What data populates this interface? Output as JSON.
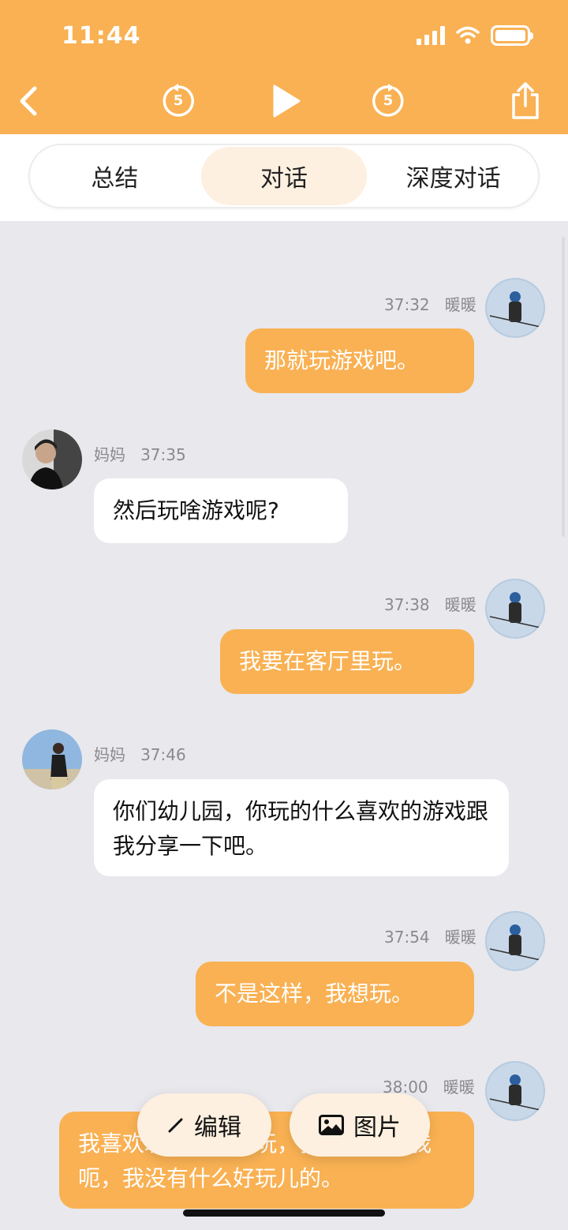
{
  "status_bar": {
    "time": "11:44"
  },
  "player": {
    "rewind_seconds": "5",
    "forward_seconds": "5"
  },
  "tabs": [
    {
      "label": "总结"
    },
    {
      "label": "对话"
    },
    {
      "label": "深度对话"
    }
  ],
  "active_tab": "对话",
  "messages": [
    {
      "sender": "暖暖",
      "time": "37:32",
      "text": "那就玩游戏吧。",
      "side": "me"
    },
    {
      "sender": "妈妈",
      "time": "37:35",
      "text": "然后玩啥游戏呢?",
      "side": "other"
    },
    {
      "sender": "暖暖",
      "time": "37:38",
      "text": "我要在客厅里玩。",
      "side": "me"
    },
    {
      "sender": "妈妈",
      "time": "37:46",
      "text": "你们幼儿园，你玩的什么喜欢的游戏跟我分享一下吧。",
      "side": "other"
    },
    {
      "sender": "暖暖",
      "time": "37:54",
      "text": "不是这样，我想玩。",
      "side": "me"
    },
    {
      "sender": "暖暖",
      "time": "38:00",
      "text": "我喜欢玩，我就想玩，我想玩儿，我呃，我没有什么好玩儿的。",
      "side": "me"
    }
  ],
  "actions": {
    "edit_label": "编辑",
    "image_label": "图片"
  },
  "colors": {
    "accent": "#f9b153",
    "background": "#e8e8ed",
    "tab_active": "#fdf0e0"
  }
}
